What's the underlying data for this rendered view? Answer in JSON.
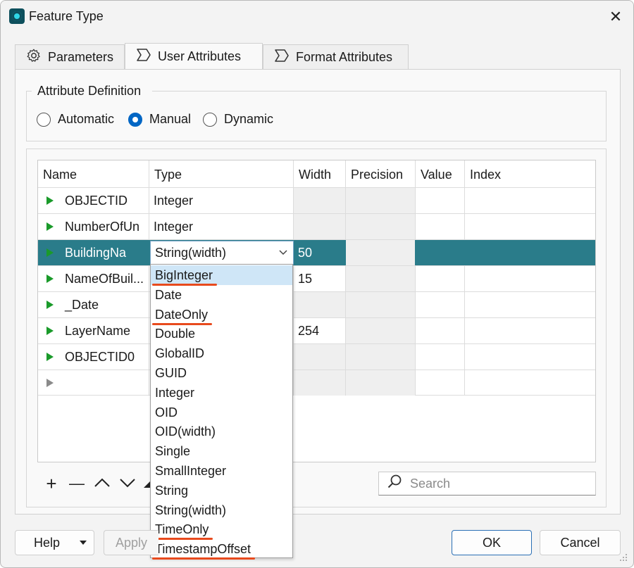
{
  "window": {
    "title": "Feature Type",
    "close_glyph": "✕"
  },
  "tabs": [
    {
      "label": "Parameters",
      "icon": "gear-icon",
      "active": false
    },
    {
      "label": "User Attributes",
      "icon": "attribute-icon",
      "active": true
    },
    {
      "label": "Format Attributes",
      "icon": "attribute-icon",
      "active": false
    }
  ],
  "attribute_definition": {
    "title": "Attribute Definition",
    "options": [
      {
        "label": "Automatic",
        "selected": false
      },
      {
        "label": "Manual",
        "selected": true
      },
      {
        "label": "Dynamic",
        "selected": false
      }
    ]
  },
  "grid": {
    "columns": [
      "Name",
      "Type",
      "Width",
      "Precision",
      "Value",
      "Index"
    ],
    "rows": [
      {
        "name": "OBJECTID",
        "type": "Integer",
        "width": "",
        "precision": "",
        "value": "",
        "index": ""
      },
      {
        "name": "NumberOfUn",
        "type": "Integer",
        "width": "",
        "precision": "",
        "value": "",
        "index": ""
      },
      {
        "name": "BuildingNa",
        "type": "String(width)",
        "width": "50",
        "precision": "",
        "value": "",
        "index": "",
        "selected": true
      },
      {
        "name": "NameOfBuil...",
        "type": "",
        "width": "15",
        "precision": "",
        "value": "",
        "index": ""
      },
      {
        "name": "_Date",
        "type": "",
        "width": "",
        "precision": "",
        "value": "",
        "index": ""
      },
      {
        "name": "LayerName",
        "type": "",
        "width": "254",
        "precision": "",
        "value": "",
        "index": ""
      },
      {
        "name": "OBJECTID0",
        "type": "",
        "width": "",
        "precision": "",
        "value": "",
        "index": ""
      },
      {
        "name": "",
        "type": "",
        "width": "",
        "precision": "",
        "value": "",
        "index": ""
      }
    ]
  },
  "type_dropdown": {
    "selected": "String(width)",
    "highlighted": "BigInteger",
    "options": [
      "BigInteger",
      "Date",
      "DateOnly",
      "Double",
      "GlobalID",
      "GUID",
      "Integer",
      "OID",
      "OID(width)",
      "Single",
      "SmallInteger",
      "String",
      "String(width)",
      "TimeOnly",
      "TimestampOffset"
    ],
    "underlined": [
      "BigInteger",
      "DateOnly",
      "TimeOnly",
      "TimestampOffset"
    ],
    "underline_color": "#e84a1d"
  },
  "toolbar": {
    "add": "+",
    "remove": "—",
    "move_up": "∧",
    "move_down": "∨"
  },
  "search": {
    "placeholder": "Search"
  },
  "buttons": {
    "help": "Help",
    "apply": "Apply",
    "ok": "OK",
    "cancel": "Cancel"
  },
  "colors": {
    "selection": "#2a7c8a",
    "accent": "#0066c4",
    "row_arrow": "#1a9a2a"
  }
}
